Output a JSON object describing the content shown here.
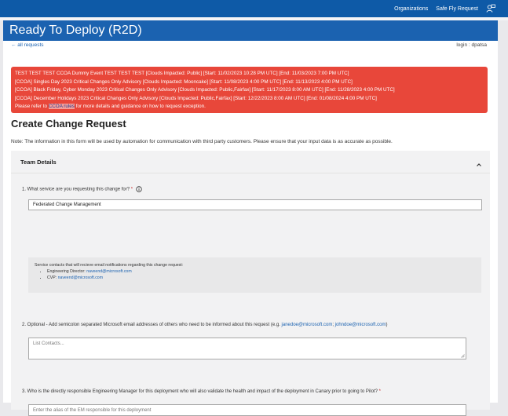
{
  "topbar": {
    "links": [
      "Organizations",
      "Safe Fly Request"
    ],
    "user_icon": "user-feedback-icon"
  },
  "app": {
    "title": "Ready To Deploy (R2D)"
  },
  "nav": {
    "back_link": "← all requests",
    "login": "login : dpatsa"
  },
  "banner": {
    "lines": [
      "TEST TEST TEST CCOA Dummy Event TEST TEST TEST [Clouds Impacted: Public] [Start: 11/02/2023 10:28 PM UTC] [End: 11/03/2023 7:00 PM UTC]",
      "[CCOA] Singles Day 2023 Critical Changes Only Advisory [Clouds Impacted: Mooncake] [Start: 11/08/2023 4:00 PM UTC] [End: 11/13/2023 4:00 PM UTC]",
      "[CCOA] Black Friday, Cyber Monday 2023 Critical Changes Only Advisory [Clouds Impacted: Public,Fairfax] [Start: 11/17/2023 8:00 AM UTC] [End: 11/28/2023 4:00 PM UTC]",
      "[CCOA] December Holidays 2023 Critical Changes Only Advisory [Clouds Impacted: Public,Fairfax] [Start: 12/22/2023 8:00 AM UTC] [End: 01/08/2024 4:00 PM UTC]"
    ],
    "footer_prefix": "Please refer to",
    "footer_link": "CCOA rules",
    "footer_suffix": "for more details and guidance on how to request exception."
  },
  "form": {
    "heading": "Create Change Request",
    "note": "Note: The information in this form will be used by automation for communication with third party customers. Please ensure that your input data is as accurate as possible.",
    "section_title": "Team Details",
    "q1": {
      "label": "1. What service are you requesting this change for?",
      "required_mark": "*",
      "value": "Federated Change Management"
    },
    "contacts": {
      "intro": "Service contacts that will recieve email notifications regarding this change request:",
      "items": [
        {
          "role": "Engineering Director:",
          "email": "naveend@microsoft.com"
        },
        {
          "role": "CVP:",
          "email": "naveend@microsoft.com"
        }
      ]
    },
    "q2": {
      "label_prefix": "2. Optional - Add semicolon separated Microsoft email addresses of others who need to be informed about this request (e.g.",
      "example1": "janedoe@microsoft.com",
      "separator": ";",
      "example2": "johndoe@microsoft.com",
      "label_suffix": ")",
      "placeholder": "List Contacts..."
    },
    "q3": {
      "label": "3. Who is the directly responsible Engineering Manager for this deployment who will also validate the health and impact of the deployment in Canary prior to going to Pilot?",
      "required_mark": "*",
      "placeholder": "Enter the alias of the EM responsible for this deployment"
    }
  },
  "colors": {
    "topbar": "#0e5aa7",
    "titlebar": "#1b62b0",
    "banner": "#e8473a",
    "link": "#1b62b0"
  }
}
